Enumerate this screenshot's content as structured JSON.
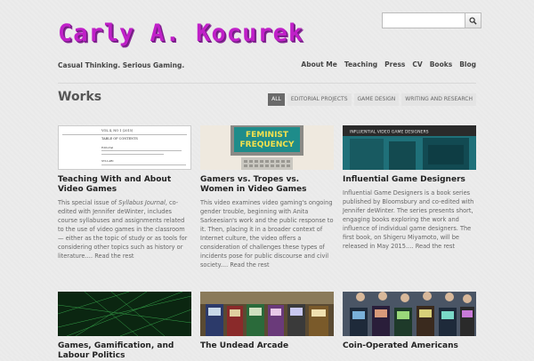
{
  "site": {
    "logo_text": "Carly A. Kocurek",
    "tagline": "Casual Thinking. Serious Gaming.",
    "search_placeholder": ""
  },
  "nav": {
    "items": [
      "About Me",
      "Teaching",
      "Press",
      "CV",
      "Books",
      "Blog"
    ]
  },
  "section": {
    "title": "Works",
    "filters": [
      {
        "label": "ALL",
        "active": true
      },
      {
        "label": "EDITORIAL PROJECTS",
        "active": false
      },
      {
        "label": "GAME DESIGN",
        "active": false
      },
      {
        "label": "WRITING AND RESEARCH",
        "active": false
      }
    ]
  },
  "cards": [
    {
      "title": "Teaching With and About Video Games",
      "excerpt_pre": "This special issue of ",
      "excerpt_em": "Syllabus Journal",
      "excerpt_post": ", co-edited with Jennifer deWinter, includes course syllabuses and assignments related to the use of video games in the classroom — either as the topic of study or as tools for considering other topics such as history or literature.…",
      "more": "Read the rest",
      "thumb_text": {
        "l1": "VOL 4, NO 1 (2015)",
        "l2": "TABLE OF CONTENTS",
        "l3": "Editorial",
        "l4": "SYLLABI"
      }
    },
    {
      "title": "Gamers vs. Tropes vs. Women in Video Games",
      "excerpt_pre": "This video examines video gaming's ongoing gender trouble, beginning with Anita Sarkeesian's work and the public response to it. Then, placing it in a broader context of Internet culture, the video offers a consideration of challenges these types of incidents pose for public discourse and civil society.…",
      "excerpt_em": "",
      "excerpt_post": "",
      "more": "Read the rest",
      "thumb_text": {
        "l1": "FEMINIST",
        "l2": "FREQUENCY"
      }
    },
    {
      "title": "Influential Game Designers",
      "excerpt_pre": "Influential Game Designers is a book series published by Bloomsbury and co-edited with Jennifer deWinter. The series presents short, engaging books exploring the work and influence of individual game designers. The first book, on Shigeru Miyamoto, will be released in May 2015.…",
      "excerpt_em": "",
      "excerpt_post": "",
      "more": "Read the rest",
      "thumb_text": {
        "l1": "INFLUENTIAL VIDEO GAME DESIGNERS"
      }
    },
    {
      "title": "Games, Gamification, and Labour Politics"
    },
    {
      "title": "The Undead Arcade"
    },
    {
      "title": "Coin-Operated Americans"
    }
  ],
  "colors": {
    "logo": "#c020c8",
    "active_filter": "#6a6a6a",
    "background": "#ececec"
  }
}
